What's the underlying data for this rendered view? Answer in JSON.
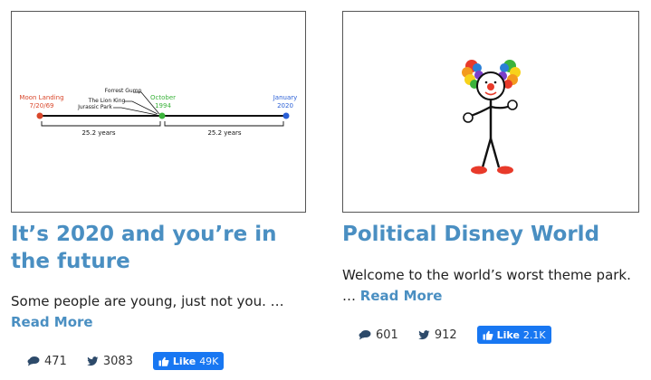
{
  "posts": [
    {
      "title": "It’s 2020 and you’re in the future",
      "excerpt": "Some people are young, just not you. … ",
      "read_more": "Read More",
      "comments": "471",
      "tweets": "3083",
      "like_label": "Like",
      "like_count": "49K",
      "illustration": {
        "left_event": "Moon Landing",
        "left_date": "7/20/69",
        "mid_event": "October",
        "mid_date": "1994",
        "right_event": "January",
        "right_date": "2020",
        "movie_1": "Forrest Gump",
        "movie_2": "The Lion King",
        "movie_3": "Jurassic Park",
        "span_left": "25.2 years",
        "span_right": "25.2 years"
      }
    },
    {
      "title": "Political Disney World",
      "excerpt": "Welcome to the world’s worst theme park. … ",
      "read_more": "Read More",
      "comments": "601",
      "tweets": "912",
      "like_label": "Like",
      "like_count": "2.1K",
      "illustration": {
        "subject": "clown stick figure"
      }
    }
  ],
  "colors": {
    "link": "#4a8fc2",
    "facebook": "#1877f2",
    "red": "#d9472b",
    "green": "#3bb33b",
    "blue": "#2a5fd6"
  },
  "icons": [
    "comment-icon",
    "twitter-bird-icon",
    "thumbs-up-icon"
  ]
}
